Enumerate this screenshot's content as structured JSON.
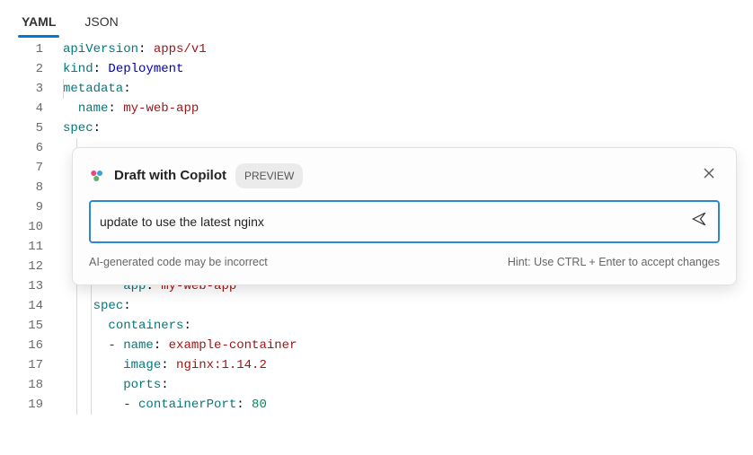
{
  "tabs": {
    "yaml": "YAML",
    "json": "JSON"
  },
  "copilot": {
    "title": "Draft with Copilot",
    "badge": "PREVIEW",
    "input_value": "update to use the latest nginx",
    "disclaimer": "AI-generated code may be incorrect",
    "hint": "Hint: Use CTRL + Enter to accept changes"
  },
  "code": {
    "l1": {
      "ln": "1",
      "key": "apiVersion",
      "val": "apps/v1"
    },
    "l2": {
      "ln": "2",
      "key": "kind",
      "val": "Deployment"
    },
    "l3": {
      "ln": "3",
      "key": "metadata"
    },
    "l4": {
      "ln": "4",
      "key": "name",
      "val": "my-web-app"
    },
    "l5": {
      "ln": "5",
      "key": "spec"
    },
    "l6": {
      "ln": "6"
    },
    "l7": {
      "ln": "7"
    },
    "l8": {
      "ln": "8"
    },
    "l9": {
      "ln": "9"
    },
    "l10": {
      "ln": "10"
    },
    "l11": {
      "ln": "11"
    },
    "l12": {
      "ln": "12"
    },
    "l13": {
      "ln": "13",
      "key": "app",
      "val": "my-web-app"
    },
    "l14": {
      "ln": "14",
      "key": "spec"
    },
    "l15": {
      "ln": "15",
      "key": "containers"
    },
    "l16": {
      "ln": "16",
      "key": "name",
      "val": "example-container"
    },
    "l17": {
      "ln": "17",
      "key": "image",
      "val": "nginx:1.14.2"
    },
    "l18": {
      "ln": "18",
      "key": "ports"
    },
    "l19": {
      "ln": "19",
      "key": "containerPort",
      "val": "80"
    }
  }
}
